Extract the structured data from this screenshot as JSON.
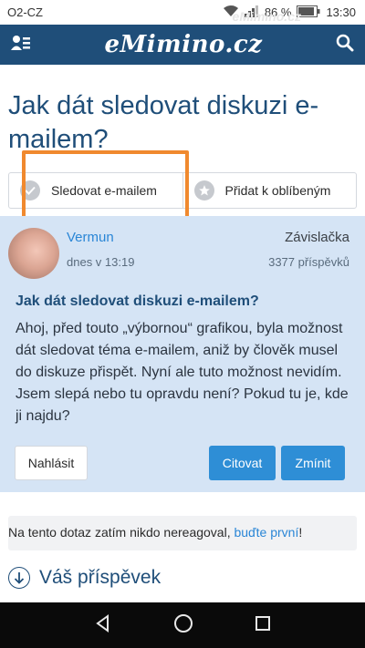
{
  "status_bar": {
    "carrier": "O2-CZ",
    "battery": "86 %",
    "time": "13:30",
    "watermark": "eMimino.cz"
  },
  "header": {
    "logo": "eMimino.cz",
    "icons": [
      "user-menu-icon",
      "search-icon"
    ],
    "background": "#1f4e79"
  },
  "page": {
    "title": "Jak dát sledovat diskuzi e-mailem?"
  },
  "actions": {
    "follow_email": "Sledovat e-mailem",
    "add_favorite": "Přidat k oblíbeným",
    "highlight_color": "#f0892e"
  },
  "post": {
    "author": "Vermun",
    "time": "dnes v 13:19",
    "location": "Závislačka",
    "post_count": "3377 příspěvků",
    "title": "Jak dát sledovat diskuzi e-mailem?",
    "body": "Ahoj, před touto „výbornou“ grafikou, byla možnost dát sledovat téma e-mailem, aniž by člověk musel do diskuze přispět. Nyní ale tuto možnost nevidím. Jsem slepá nebo tu opravdu není? Pokud tu je, kde ji najdu?",
    "report_label": "Nahlásit",
    "quote_label": "Citovat",
    "mention_label": "Zmínit",
    "background": "#d5e4f5",
    "accent": "#2e8ed6"
  },
  "notice": {
    "text": "Na tento dotaz zatím nikdo nereagoval, ",
    "link": "buďte první",
    "suffix": "!"
  },
  "your_post": {
    "label": "Váš příspěvek"
  },
  "nav": {
    "icons": [
      "back-icon",
      "home-icon",
      "recents-icon"
    ]
  }
}
